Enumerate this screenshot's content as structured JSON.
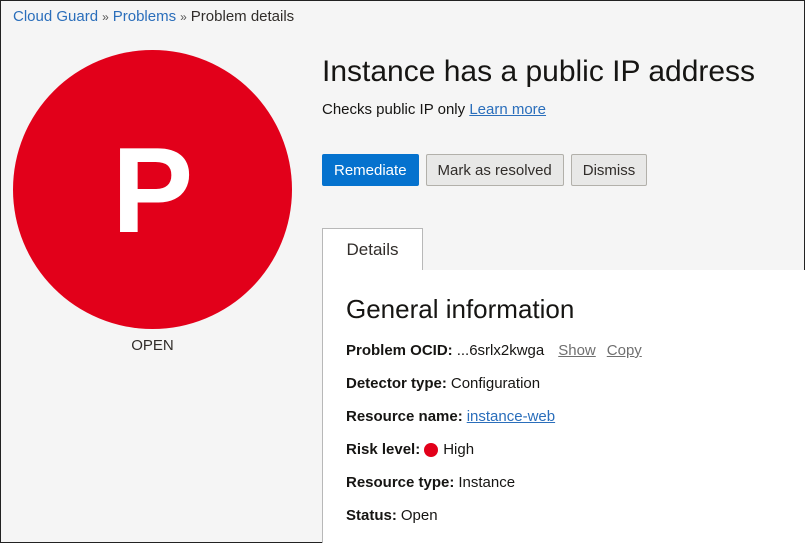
{
  "breadcrumb": {
    "items": [
      "Cloud Guard",
      "Problems",
      "Problem details"
    ],
    "separator": "»"
  },
  "badge": {
    "letter": "P",
    "color": "#e2001a",
    "status": "OPEN"
  },
  "problem": {
    "title": "Instance has a public IP address",
    "description": "Checks public IP only",
    "learn_more": "Learn more"
  },
  "actions": {
    "remediate": "Remediate",
    "mark_resolved": "Mark as resolved",
    "dismiss": "Dismiss"
  },
  "tabs": [
    {
      "label": "Details",
      "selected": true
    }
  ],
  "general_info": {
    "heading": "General information",
    "ocid": {
      "label": "Problem OCID:",
      "value": "...6srlx2kwga",
      "show": "Show",
      "copy": "Copy"
    },
    "detector": {
      "label": "Detector type:",
      "value": "Configuration"
    },
    "resource_name": {
      "label": "Resource name:",
      "value": "instance-web"
    },
    "risk": {
      "label": "Risk level:",
      "value": "High",
      "color": "#e2001a"
    },
    "resource_type": {
      "label": "Resource type:",
      "value": "Instance"
    },
    "status": {
      "label": "Status:",
      "value": "Open"
    }
  }
}
